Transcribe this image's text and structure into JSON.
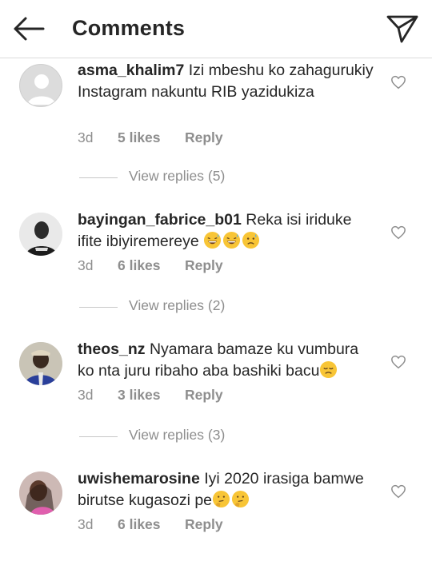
{
  "header": {
    "title": "Comments",
    "back_icon": "arrow-left-icon",
    "send_icon": "paper-plane-icon"
  },
  "comments": [
    {
      "username": "asma_khalim7",
      "text": "Izi mbeshu ko zahagurukiy Instagram nakuntu RIB yazidukiza",
      "time": "3d",
      "likes": "5 likes",
      "reply": "Reply",
      "view_replies": "View replies (5)",
      "avatar": "default-avatar"
    },
    {
      "username": "bayingan_fabrice_b01",
      "text": "Reka isi iriduke ifite ibiyiremereye",
      "emojis": [
        "grinning-sweat-emoji",
        "grinning-sweat-emoji",
        "worried-sweat-emoji"
      ],
      "time": "3d",
      "likes": "6 likes",
      "reply": "Reply",
      "view_replies": "View replies (2)",
      "avatar": "user-photo"
    },
    {
      "username": "theos_nz",
      "text": "Nyamara bamaze ku vumbura ko nta juru ribaho aba bashiki bacu",
      "emojis": [
        "disappointed-emoji"
      ],
      "time": "3d",
      "likes": "3 likes",
      "reply": "Reply",
      "view_replies": "View replies (3)",
      "avatar": "user-photo"
    },
    {
      "username": "uwishemarosine",
      "text": "Iyi 2020 irasiga bamwe birutse kugasozi pe",
      "emojis": [
        "thinking-emoji",
        "thinking-emoji"
      ],
      "time": "3d",
      "likes": "6 likes",
      "reply": "Reply",
      "avatar": "user-photo"
    }
  ],
  "colors": {
    "text": "#262626",
    "secondary": "#8e8e8e",
    "divider": "#dbdbdb"
  }
}
